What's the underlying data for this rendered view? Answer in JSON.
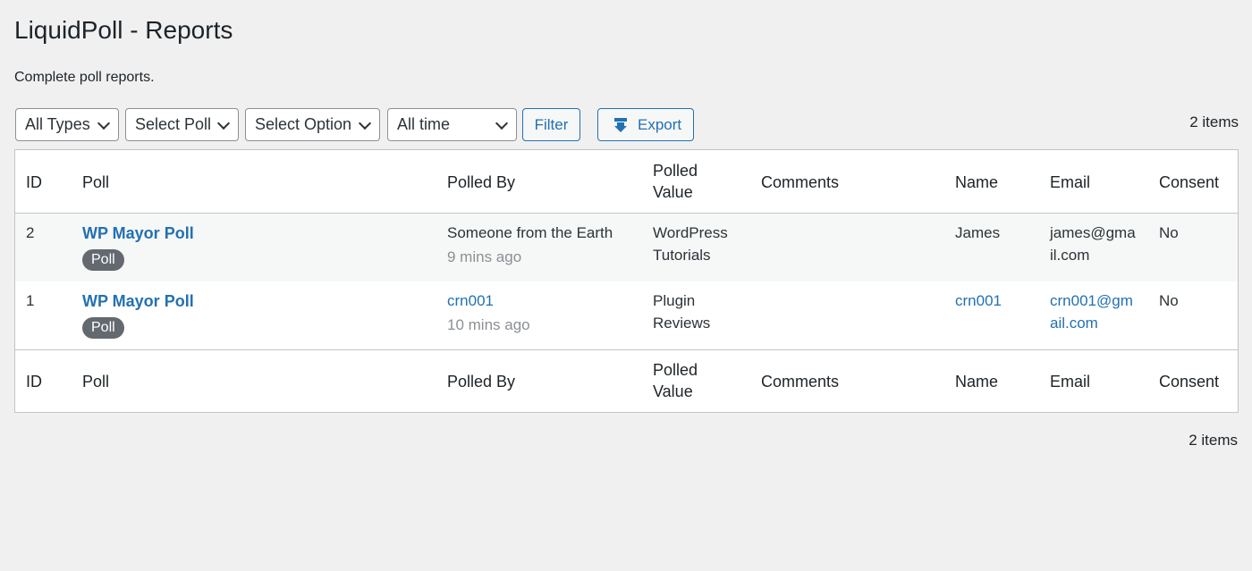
{
  "header": {
    "title": "LiquidPoll - Reports",
    "description": "Complete poll reports."
  },
  "filters": {
    "type_select": "All Types",
    "poll_select": "Select Poll",
    "option_select": "Select Option",
    "time_select": "All time",
    "filter_button": "Filter",
    "export_button": "Export"
  },
  "pagination": {
    "items_top": "2 items",
    "items_bottom": "2 items"
  },
  "table": {
    "columns": [
      "ID",
      "Poll",
      "Polled By",
      "Polled\nValue",
      "Comments",
      "Name",
      "Email",
      "Consent"
    ],
    "column_labels": {
      "id": "ID",
      "poll": "Poll",
      "polled_by": "Polled By",
      "polled_value_1": "Polled",
      "polled_value_2": "Value",
      "comments": "Comments",
      "name": "Name",
      "email": "Email",
      "consent": "Consent"
    },
    "rows": [
      {
        "id": "2",
        "poll": "WP Mayor Poll",
        "type": "Poll",
        "polled_by": "Someone from the Earth",
        "time": "9 mins ago",
        "polled_value_1": "WordPress",
        "polled_value_2": "Tutorials",
        "comments": "",
        "name": "James",
        "email_1": "james@gma",
        "email_2": "il.com",
        "consent": "No"
      },
      {
        "id": "1",
        "poll": "WP Mayor Poll",
        "type": "Poll",
        "polled_by": "crn001",
        "time": "10 mins ago",
        "polled_value_1": "Plugin",
        "polled_value_2": "Reviews",
        "comments": "",
        "name": "crn001",
        "email_1": "crn001@gm",
        "email_2": "ail.com",
        "consent": "No"
      }
    ]
  },
  "icons": {
    "select_chevron": "chevron-down-icon",
    "export_icon": "download-icon"
  },
  "colors": {
    "accent": "#2271b1",
    "background": "#f0f0f1",
    "badge": "#646970"
  }
}
